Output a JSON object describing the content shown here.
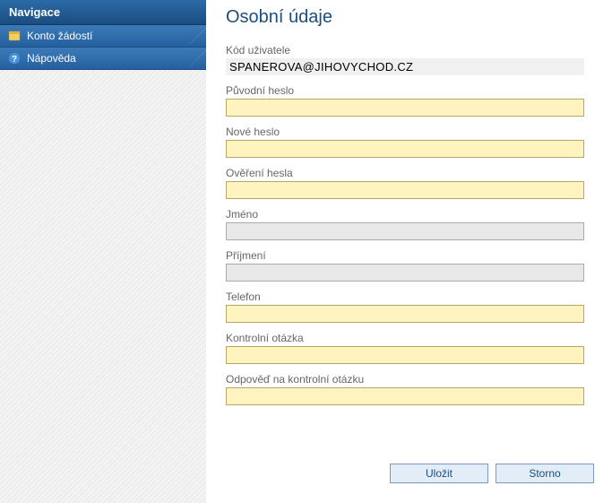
{
  "sidebar": {
    "header": "Navigace",
    "items": [
      {
        "label": "Konto žádostí"
      },
      {
        "label": "Nápověda"
      }
    ]
  },
  "main": {
    "title": "Osobní údaje",
    "user_code_label": "Kód uživatele",
    "user_code_value": "SPANEROVA@JIHOVYCHOD.CZ",
    "fields": {
      "original_password": {
        "label": "Původní heslo",
        "value": ""
      },
      "new_password": {
        "label": "Nové heslo",
        "value": ""
      },
      "confirm_password": {
        "label": "Ověření hesla",
        "value": ""
      },
      "first_name": {
        "label": "Jméno",
        "value": ""
      },
      "last_name": {
        "label": "Příjmení",
        "value": ""
      },
      "phone": {
        "label": "Telefon",
        "value": ""
      },
      "security_question": {
        "label": "Kontrolní otázka",
        "value": ""
      },
      "security_answer": {
        "label": "Odpověď na kontrolní otázku",
        "value": ""
      }
    },
    "buttons": {
      "save": "Uložit",
      "cancel": "Storno"
    }
  }
}
